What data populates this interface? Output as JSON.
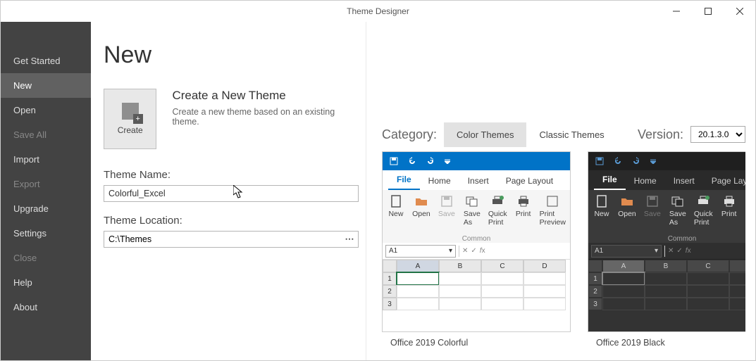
{
  "window": {
    "title": "Theme Designer"
  },
  "sidebar": {
    "items": [
      {
        "label": "Get Started",
        "active": false,
        "disabled": false
      },
      {
        "label": "New",
        "active": true,
        "disabled": false
      },
      {
        "label": "Open",
        "active": false,
        "disabled": false
      },
      {
        "label": "Save All",
        "active": false,
        "disabled": true
      },
      {
        "label": "Import",
        "active": false,
        "disabled": false
      },
      {
        "label": "Export",
        "active": false,
        "disabled": true
      },
      {
        "label": "Upgrade",
        "active": false,
        "disabled": false
      },
      {
        "label": "Settings",
        "active": false,
        "disabled": false
      },
      {
        "label": "Close",
        "active": false,
        "disabled": true
      },
      {
        "label": "Help",
        "active": false,
        "disabled": false
      },
      {
        "label": "About",
        "active": false,
        "disabled": false
      }
    ]
  },
  "page": {
    "title": "New",
    "create_tile_label": "Create",
    "create_heading": "Create a New Theme",
    "create_desc": "Create a new theme based on an existing theme.",
    "theme_name_label": "Theme Name:",
    "theme_name_value": "Colorful_Excel",
    "theme_location_label": "Theme Location:",
    "theme_location_value": "C:\\Themes"
  },
  "category": {
    "label": "Category:",
    "tabs": [
      {
        "label": "Color Themes",
        "active": true
      },
      {
        "label": "Classic Themes",
        "active": false
      }
    ]
  },
  "version": {
    "label": "Version:",
    "value": "20.1.3.0"
  },
  "ribbon": {
    "tabs": [
      "File",
      "Home",
      "Insert",
      "Page Layout"
    ],
    "buttons": [
      {
        "label": "New"
      },
      {
        "label": "Open"
      },
      {
        "label": "Save",
        "disabled": true
      },
      {
        "label": "Save\nAs"
      },
      {
        "label": "Quick\nPrint"
      },
      {
        "label": "Print"
      },
      {
        "label": "Print\nPreview"
      }
    ],
    "group": "Common",
    "namebox": "A1",
    "cols": [
      "A",
      "B",
      "C",
      "D"
    ],
    "rows": [
      "1",
      "2",
      "3"
    ]
  },
  "previews": [
    {
      "name": "Office 2019 Colorful",
      "dark": false
    },
    {
      "name": "Office 2019 Black",
      "dark": true
    }
  ]
}
